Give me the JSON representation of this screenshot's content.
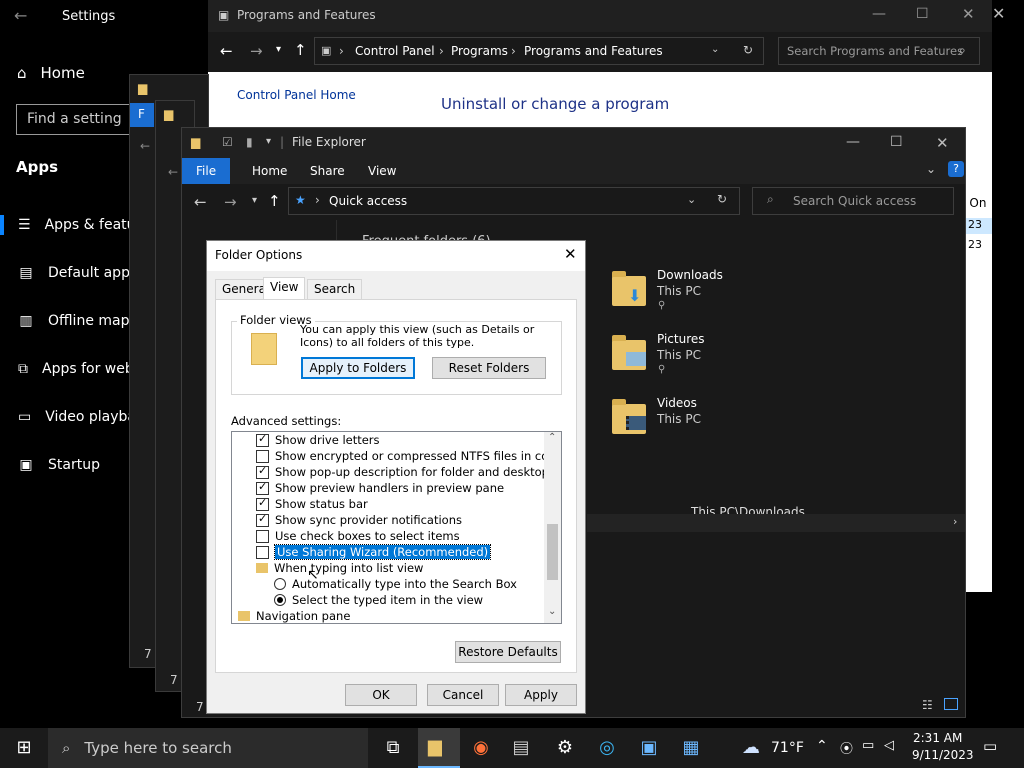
{
  "settings": {
    "title": "Settings",
    "home": "Home",
    "search_placeholder": "Find a setting",
    "section": "Apps",
    "nav": [
      {
        "label": "Apps & features",
        "icon": "list-icon"
      },
      {
        "label": "Default apps",
        "icon": "default-apps-icon"
      },
      {
        "label": "Offline maps",
        "icon": "map-icon"
      },
      {
        "label": "Apps for websites",
        "icon": "link-icon"
      },
      {
        "label": "Video playback",
        "icon": "video-icon"
      },
      {
        "label": "Startup",
        "icon": "startup-icon"
      }
    ]
  },
  "control_panel": {
    "title": "Programs and Features",
    "breadcrumb": [
      "Control Panel",
      "Programs",
      "Programs and Features"
    ],
    "search_placeholder": "Search Programs and Features",
    "sidebar_link": "Control Panel Home",
    "heading": "Uninstall or change a program",
    "column_peek": "d On",
    "date_peek_1": "23",
    "date_peek_2": "23"
  },
  "ghost_windows": {
    "status_a": "7 i",
    "status_b": "7",
    "status_c": "7",
    "label_a": "F"
  },
  "explorer": {
    "title": "File Explorer",
    "ribbon": [
      "File",
      "Home",
      "Share",
      "View"
    ],
    "address": "Quick access",
    "search_placeholder": "Search Quick access",
    "frequent_label": "Frequent folders (6)",
    "folders": [
      {
        "name": "Downloads",
        "location": "This PC"
      },
      {
        "name": "Pictures",
        "location": "This PC"
      },
      {
        "name": "Videos",
        "location": "This PC"
      }
    ],
    "recent_path": "This PC\\Downloads"
  },
  "folder_options": {
    "title": "Folder Options",
    "tabs": [
      "General",
      "View",
      "Search"
    ],
    "folder_views_label": "Folder views",
    "folder_views_text": "You can apply this view (such as Details or Icons) to all folders of this type.",
    "apply_to_folders": "Apply to Folders",
    "reset_folders": "Reset Folders",
    "advanced_label": "Advanced settings:",
    "items": [
      {
        "type": "check",
        "checked": true,
        "label": "Show drive letters"
      },
      {
        "type": "check",
        "checked": false,
        "label": "Show encrypted or compressed NTFS files in color"
      },
      {
        "type": "check",
        "checked": true,
        "label": "Show pop-up description for folder and desktop items"
      },
      {
        "type": "check",
        "checked": true,
        "label": "Show preview handlers in preview pane"
      },
      {
        "type": "check",
        "checked": true,
        "label": "Show status bar"
      },
      {
        "type": "check",
        "checked": true,
        "label": "Show sync provider notifications"
      },
      {
        "type": "check",
        "checked": false,
        "label": "Use check boxes to select items"
      },
      {
        "type": "check",
        "checked": false,
        "label": "Use Sharing Wizard (Recommended)",
        "selected": true
      },
      {
        "type": "folder",
        "label": "When typing into list view"
      },
      {
        "type": "radio",
        "checked": false,
        "label": "Automatically type into the Search Box"
      },
      {
        "type": "radio",
        "checked": true,
        "label": "Select the typed item in the view"
      },
      {
        "type": "folder",
        "label": "Navigation pane"
      }
    ],
    "restore_defaults": "Restore Defaults",
    "ok": "OK",
    "cancel": "Cancel",
    "apply": "Apply"
  },
  "taskbar": {
    "search_placeholder": "Type here to search",
    "weather": "71°F",
    "time": "2:31 AM",
    "date": "9/11/2023"
  },
  "colors": {
    "accent": "#0078d7",
    "file_tab": "#1a6dd1",
    "folder": "#e9c46a"
  }
}
